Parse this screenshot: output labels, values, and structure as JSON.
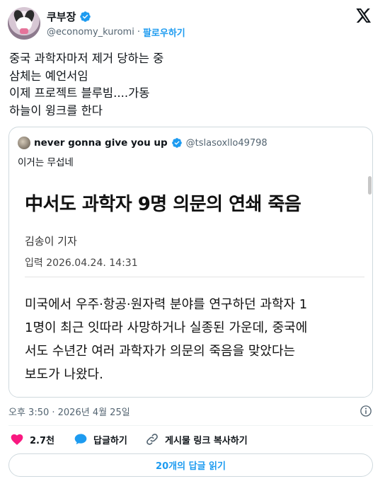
{
  "author": {
    "display_name": "쿠부장",
    "handle": "@economy_kuromi",
    "separator": "·",
    "follow_label": "팔로우하기",
    "verified_color": "#1d9bf0"
  },
  "tweet": {
    "lines": [
      "중국 과학자마저 제거 당하는 중",
      "삼체는 예언서임",
      "이제 프로젝트 블루빔....가동",
      "하늘이 윙크를 한다"
    ]
  },
  "quote": {
    "display_name": "never gonna give you up",
    "handle": "@tslasoxllo49798",
    "text": "이거는 무섭네",
    "article": {
      "title": "中서도 과학자 9명 의문의 연쇄 죽음",
      "reporter": "김송이 기자",
      "date": "입력 2026.04.24. 14:31",
      "body": [
        "미국에서 우주·항공·원자력 분야를 연구하던 과학자 1",
        "1명이 최근 잇따라 사망하거나 실종된 가운데, 중국에",
        "서도 수년간 여러 과학자가 의문의 죽음을 맞았다는",
        "보도가 나왔다."
      ]
    }
  },
  "meta": {
    "timestamp": "오후 3:50 · 2026년 4월 25일"
  },
  "actions": {
    "like_count": "2.7천",
    "reply_label": "답글하기",
    "copy_label": "게시물 링크 복사하기",
    "like_color": "#f91880",
    "reply_color": "#1d9bf0"
  },
  "read_replies_label": "20개의 답글 읽기",
  "icons": [
    "verified-badge-icon",
    "x-logo-icon",
    "info-icon",
    "heart-icon",
    "reply-bubble-icon",
    "link-icon"
  ]
}
